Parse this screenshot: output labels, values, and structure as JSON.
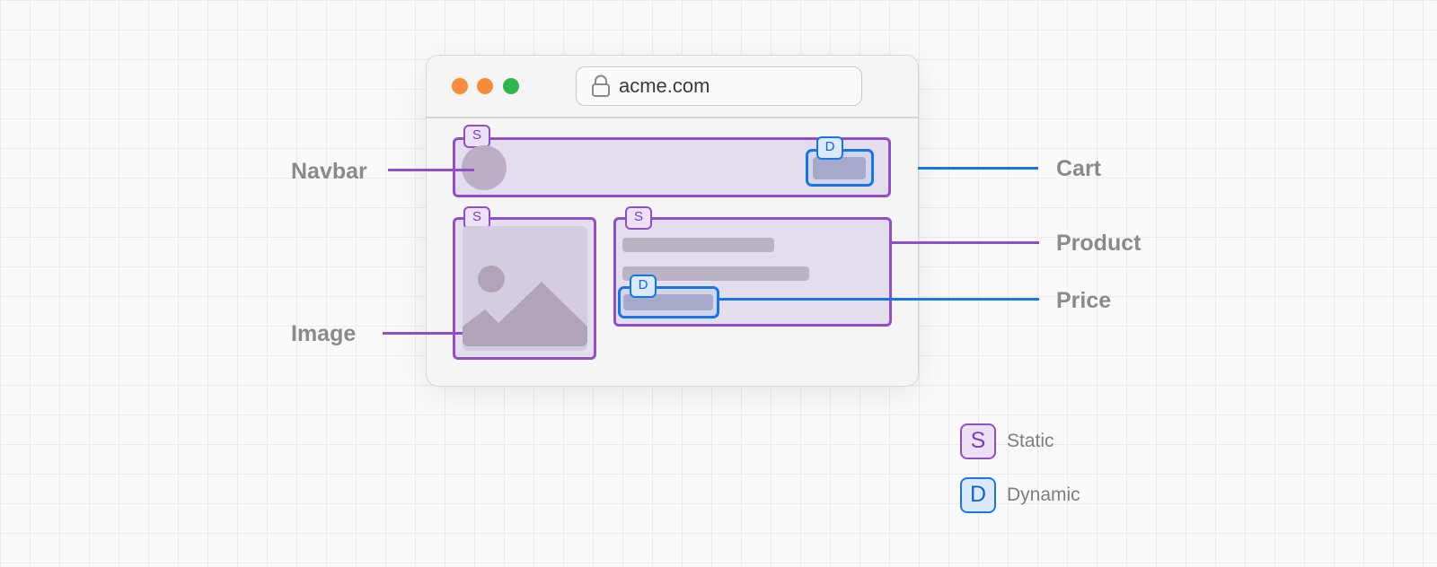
{
  "browser": {
    "url": "acme.com"
  },
  "badges": {
    "static_letter": "S",
    "dynamic_letter": "D"
  },
  "annotations": {
    "navbar": "Navbar",
    "image": "Image",
    "cart": "Cart",
    "product": "Product",
    "price": "Price"
  },
  "legend": {
    "static_label": "Static",
    "dynamic_label": "Dynamic"
  },
  "colors": {
    "static": "#8f4fc7",
    "dynamic": "#1676e8",
    "dot_orange": "#f78d3c",
    "dot_green": "#2fb54a"
  },
  "icons": [
    "lock-icon",
    "image-placeholder-icon",
    "avatar-placeholder"
  ]
}
